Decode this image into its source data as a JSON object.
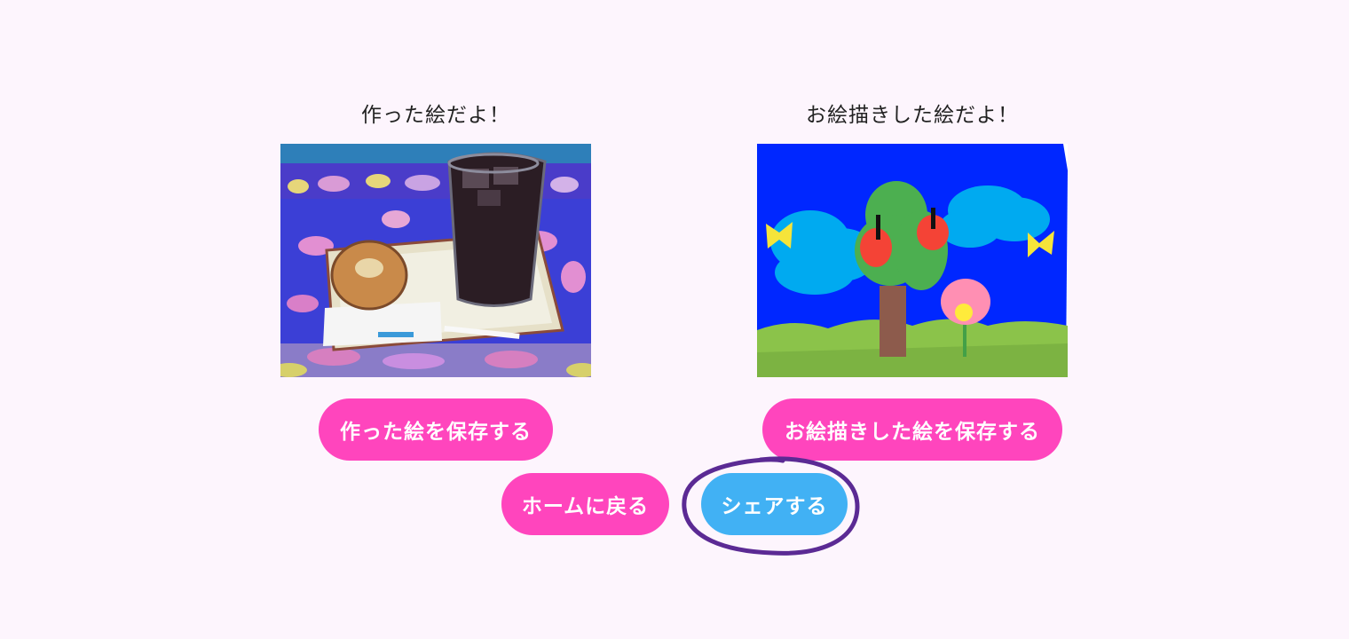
{
  "captions": {
    "made": "作った絵だよ！",
    "drawn": "お絵描きした絵だよ！"
  },
  "buttons": {
    "save_made": "作った絵を保存する",
    "save_drawn": "お絵描きした絵を保存する",
    "home": "ホームに戻る",
    "share": "シェアする"
  },
  "colors": {
    "background": "#fdf5fd",
    "pink_button": "#ff45bd",
    "blue_button": "#41b1f4",
    "highlight_ring": "#5b2a94"
  }
}
